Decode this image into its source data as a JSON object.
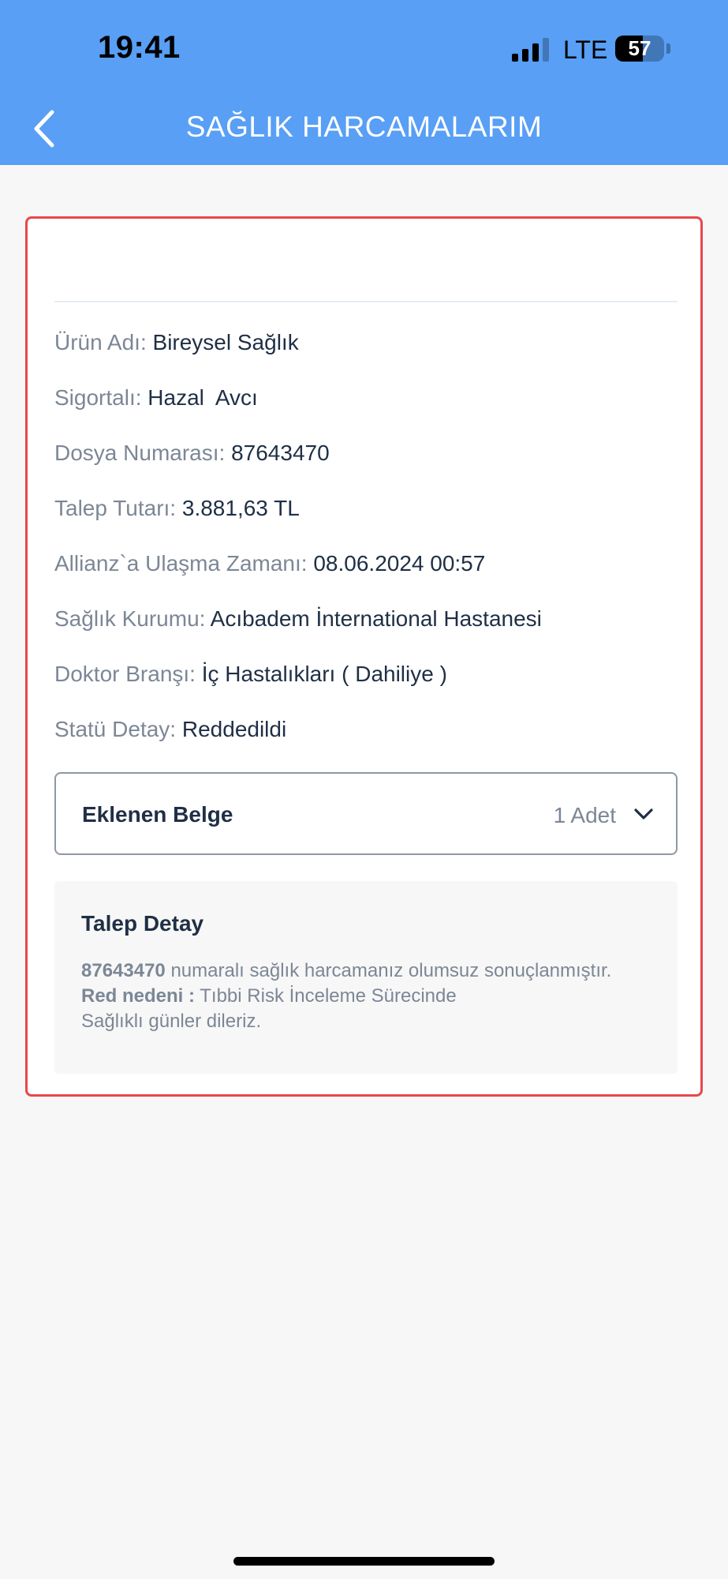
{
  "status_bar": {
    "time": "19:41",
    "network": "LTE",
    "battery": "57",
    "battery_level_percent": 57
  },
  "header": {
    "title": "SAĞLIK HARCAMALARIM",
    "back_icon": "chevron-left-icon",
    "background_color": "#589ff5"
  },
  "card": {
    "border_color": "#e8474b",
    "rows": [
      {
        "label": "Ürün Adı:",
        "value": "Bireysel Sağlık"
      },
      {
        "label": "Sigortalı:",
        "value": "Hazal  Avcı"
      },
      {
        "label": "Dosya Numarası:",
        "value": "87643470"
      },
      {
        "label": "Talep Tutarı:",
        "value": "3.881,63 TL"
      },
      {
        "label": "Allianz`a Ulaşma Zamanı:",
        "value": "08.06.2024 00:57"
      },
      {
        "label": "Sağlık Kurumu:",
        "value": "Acıbadem İnternational Hastanesi"
      },
      {
        "label": "Doktor Branşı:",
        "value": "İç Hastalıkları ( Dahiliye )"
      },
      {
        "label": "Statü Detay:",
        "value": "Reddedildi"
      }
    ],
    "documents": {
      "title": "Eklenen Belge",
      "count": "1 Adet",
      "icon": "chevron-down-icon"
    },
    "detail": {
      "title": "Talep Detay",
      "line1_bold": "87643470",
      "line1_text": " numaralı sağlık harcamanız olumsuz sonuçlanmıştır.",
      "line2_bold": "Red nedeni :",
      "line2_text": " Tıbbi Risk İnceleme Sürecinde",
      "line3_text": "Sağlıklı günler dileriz."
    }
  }
}
